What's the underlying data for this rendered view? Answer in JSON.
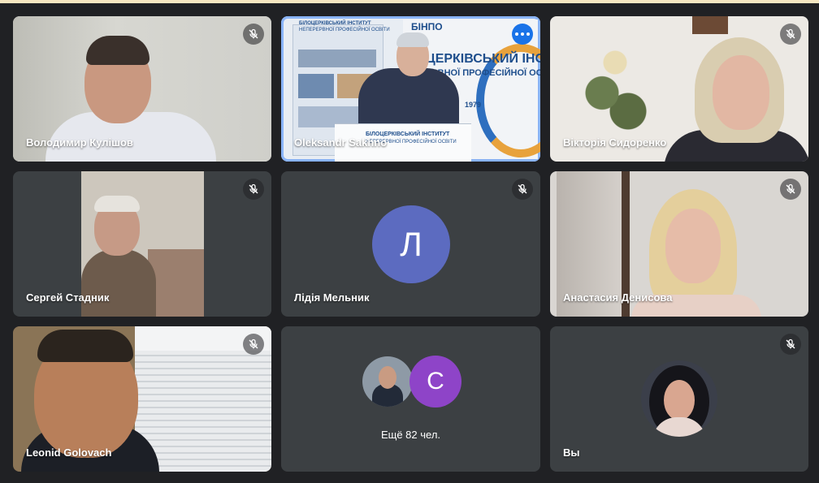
{
  "participants": [
    {
      "name": "Володимир Кулішов"
    },
    {
      "name": "Oleksandr Sakhno"
    },
    {
      "name": "Вікторія Сидоренко"
    },
    {
      "name": "Сергей Стадник"
    },
    {
      "name": "Лідія Мельник",
      "initial": "Л"
    },
    {
      "name": "Анастасия Денисова"
    },
    {
      "name": "Leonid Golovach"
    },
    {
      "initial": "С",
      "more_label": "Ещё 82 чел."
    },
    {
      "name": "Вы"
    }
  ],
  "banner": {
    "tag": "БІНПО",
    "line1": "БІЛОЦЕРКІВСЬКИЙ ІНСТИТУТ",
    "line2": "НЕПЕРЕРВНОЇ ПРОФЕСІЙНОЇ ОСВІТИ",
    "big1": "ЦЕРКІВСЬКИЙ ІНСТИ",
    "big2": "ЕРВНОЇ ПРОФЕСІЙНОЇ ОСВ",
    "year": "1979"
  },
  "colors": {
    "background": "#202124",
    "tile": "#3c4043",
    "accent": "#8ab4f8",
    "avatar_l": "#5c6bc0",
    "avatar_s": "#8e44c8",
    "more_button": "#1a73e8"
  },
  "icons": {
    "mute": "mic-off-icon",
    "more": "more-options-icon"
  }
}
